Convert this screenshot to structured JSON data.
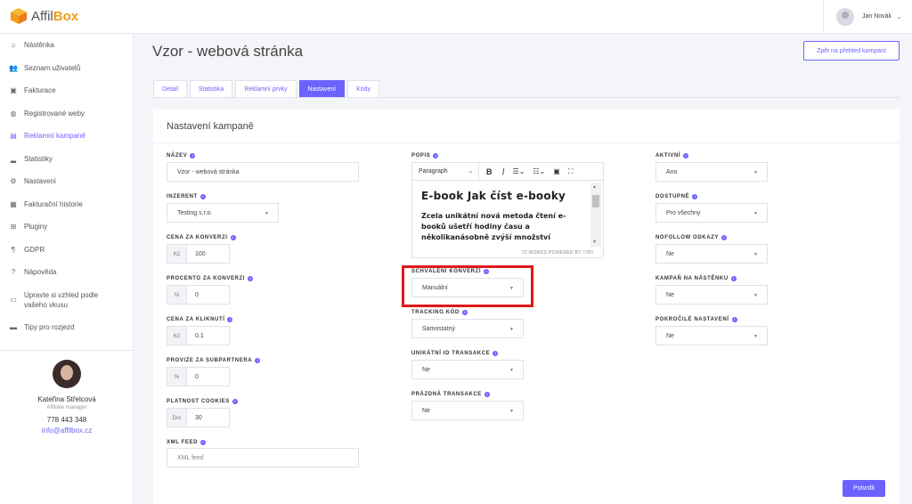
{
  "brand": {
    "logo_part1": "Affil",
    "logo_part2": "Box",
    "accent": "#6c63ff",
    "logo_color": "#f39c12"
  },
  "header": {
    "user_name": "Jan Novák"
  },
  "sidebar": {
    "items": [
      {
        "label": "Nástěnka",
        "icon": "home-icon"
      },
      {
        "label": "Seznam uživatelů",
        "icon": "users-icon"
      },
      {
        "label": "Fakturace",
        "icon": "billing-icon"
      },
      {
        "label": "Registrované weby",
        "icon": "globe-icon"
      },
      {
        "label": "Reklamní kampaně",
        "icon": "campaign-icon",
        "active": true
      },
      {
        "label": "Statistiky",
        "icon": "stats-icon"
      },
      {
        "label": "Nastavení",
        "icon": "gear-icon"
      },
      {
        "label": "Fakturační historie",
        "icon": "history-icon"
      },
      {
        "label": "Pluginy",
        "icon": "plugin-icon"
      },
      {
        "label": "GDPR",
        "icon": "gdpr-icon"
      },
      {
        "label": "Nápověda",
        "icon": "help-icon"
      },
      {
        "label": "Upravte si vzhled podle vašeho vkusu",
        "icon": "appearance-icon"
      },
      {
        "label": "Tipy pro rozjezd",
        "icon": "tips-icon"
      }
    ],
    "manager": {
      "name": "Kateřina Střelcová",
      "role": "Affiliate manager",
      "phone": "778 443 348",
      "email": "info@affilbox.cz"
    }
  },
  "main": {
    "title": "Vzor - webová stránka",
    "back_button": "Zpět na přehled kampaní",
    "tabs": [
      "Detail",
      "Statistika",
      "Reklamní prvky",
      "Nastavení",
      "Kódy"
    ],
    "active_tab": "Nastavení",
    "card_title": "Nastavení kampaně",
    "submit": "Potvrdit"
  },
  "form": {
    "name": {
      "label": "NÁZEV",
      "value": "Vzor - webová stránka"
    },
    "advertiser": {
      "label": "INZERENT",
      "value": "Testing s.r.o."
    },
    "price_per_conversion": {
      "label": "CENA ZA KONVERZI",
      "prefix": "Kč",
      "value": "100"
    },
    "percent_per_conversion": {
      "label": "PROCENTO ZA KONVERZI",
      "prefix": "%",
      "value": "0"
    },
    "price_per_click": {
      "label": "CENA ZA KLIKNUTÍ",
      "prefix": "Kč",
      "value": "0.1"
    },
    "subpartner_commission": {
      "label": "PROVIZE ZA SUBPARTNERA",
      "prefix": "%",
      "value": "0"
    },
    "cookie_validity": {
      "label": "PLATNOST COOKIES",
      "prefix": "Dní",
      "value": "30"
    },
    "xml_feed": {
      "label": "XML FEED",
      "placeholder": "XML feed"
    },
    "description": {
      "label": "POPIS",
      "format": "Paragraph",
      "heading": "E-book Jak číst e-booky",
      "text": "Zcela unikátní nová metoda čtení e-booků ušetří hodiny času a několikanásobně zvýší množství",
      "status": "72 WORDS  POWERED BY TINY"
    },
    "conversion_approval": {
      "label": "SCHVÁLENÍ KONVERZÍ",
      "value": "Manuální"
    },
    "tracking_code": {
      "label": "TRACKING KÓD",
      "value": "Samostatný"
    },
    "unique_transaction_id": {
      "label": "UNIKÁTNÍ ID TRANSAKCE",
      "value": "Ne"
    },
    "empty_transaction": {
      "label": "PRÁZDNÁ TRANSAKCE",
      "value": "Ne"
    },
    "active": {
      "label": "AKTIVNÍ",
      "value": "Ano"
    },
    "available": {
      "label": "DOSTUPNÉ",
      "value": "Pro všechny"
    },
    "nofollow": {
      "label": "NOFOLLOW ODKAZY",
      "value": "Ne"
    },
    "dashboard_campaign": {
      "label": "KAMPAŇ NA NÁSTĚNKU",
      "value": "Ne"
    },
    "advanced": {
      "label": "POKROČILÉ NASTAVENÍ",
      "value": "Ne"
    }
  }
}
